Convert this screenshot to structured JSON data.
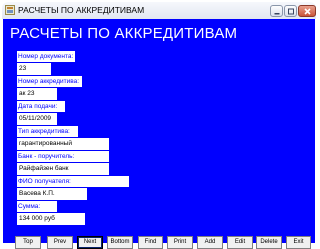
{
  "window": {
    "title": "РАСЧЕТЫ ПО АККРЕДИТИВАМ"
  },
  "header": {
    "title": "РАСЧЕТЫ ПО АККРЕДИТИВАМ"
  },
  "fields": [
    {
      "label": "Номер документа:",
      "value": "23"
    },
    {
      "label": "Номер аккредитива:",
      "value": "ак 23"
    },
    {
      "label": "Дата подачи:",
      "value": "05/11/2009"
    },
    {
      "label": "Тип аккредитива:",
      "value": "гарантированный"
    },
    {
      "label": "Банк - поручитель:",
      "value": "Райфайзен банк"
    },
    {
      "label": "ФИО получателя:",
      "value": "Васева К.П."
    },
    {
      "label": "Сумма:",
      "value": "134 000 руб"
    }
  ],
  "buttons": [
    {
      "label": "Top"
    },
    {
      "label": "Prev"
    },
    {
      "label": "Next"
    },
    {
      "label": "Bottom"
    },
    {
      "label": "Find"
    },
    {
      "label": "Print"
    },
    {
      "label": "Add"
    },
    {
      "label": "Edit"
    },
    {
      "label": "Delete"
    },
    {
      "label": "Exit"
    }
  ],
  "colors": {
    "background": "#0000ff",
    "label_text": "#0000ff",
    "header_text": "#ffffff"
  }
}
